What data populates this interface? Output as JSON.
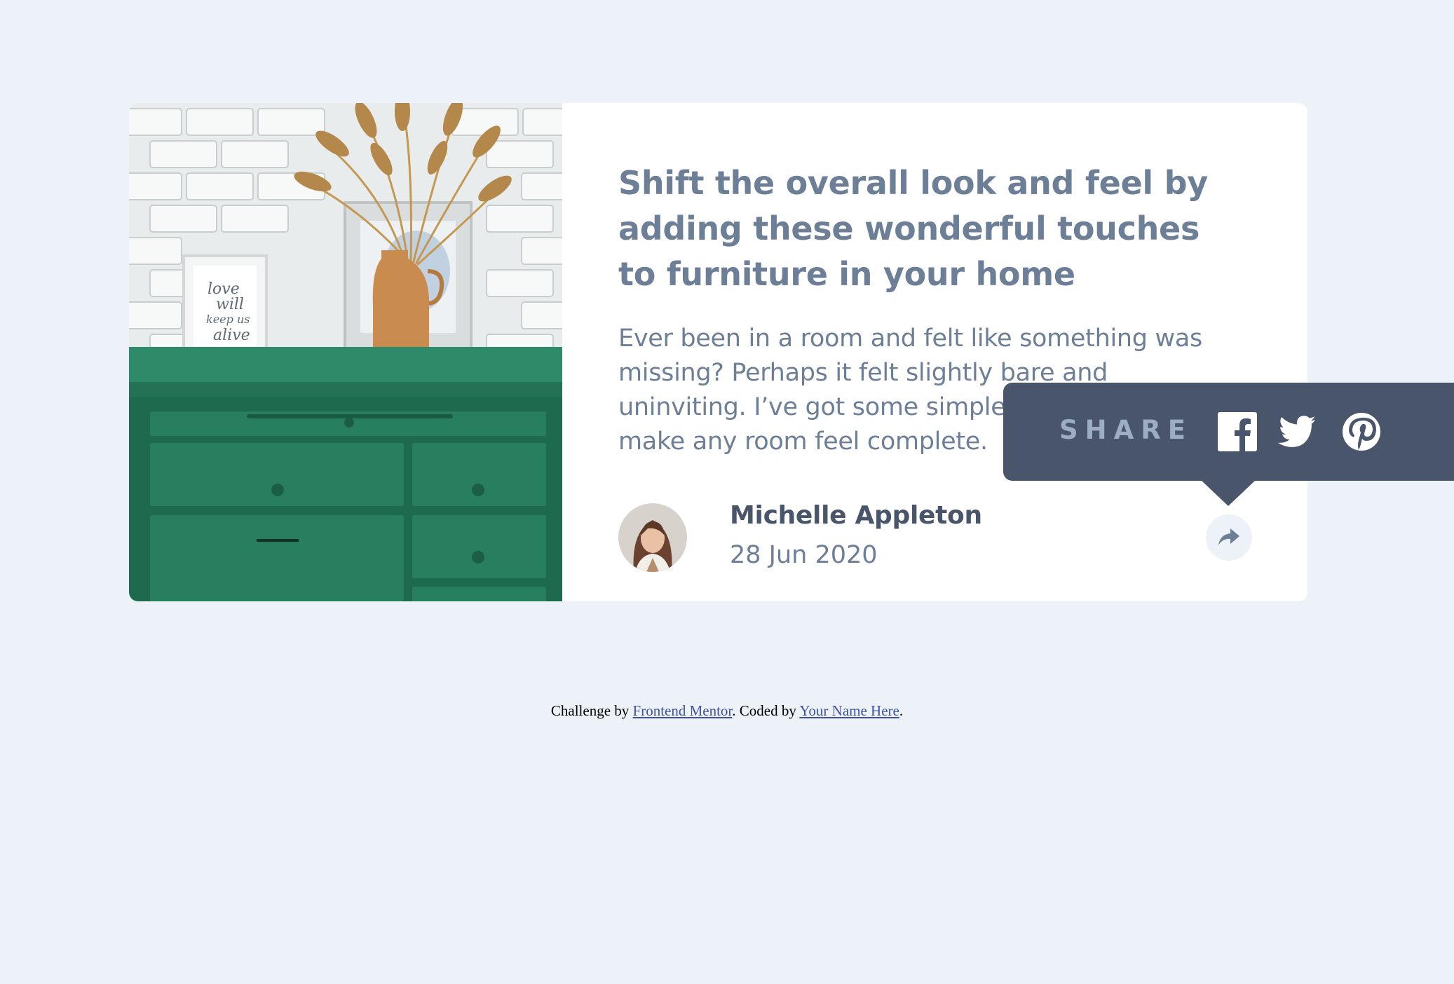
{
  "article": {
    "title": "Shift the overall look and feel by adding these wonderful touches to furniture in your home",
    "description": "Ever been in a room and felt like something was missing? Perhaps it felt slightly bare and uninviting. I’ve got some simple tips to help you make any room feel complete."
  },
  "author": {
    "name": "Michelle Appleton",
    "date": "28 Jun 2020"
  },
  "photo": {
    "frame_text": [
      "love",
      "will",
      "keep us",
      "alive"
    ]
  },
  "share": {
    "label": "SHARE",
    "icons": [
      "facebook-icon",
      "twitter-icon",
      "pinterest-icon",
      "share-icon"
    ]
  },
  "footer": {
    "prefix": "Challenge by ",
    "link1": "Frontend Mentor",
    "middle": ". Coded by ",
    "link2": "Your Name Here",
    "suffix": "."
  },
  "colors": {
    "background": "#ECF2F8",
    "card": "#FFFFFF",
    "heading": "#6D7F97",
    "dark": "#48556A",
    "muted": "#9DAEC2",
    "link": "#3E52A3"
  }
}
